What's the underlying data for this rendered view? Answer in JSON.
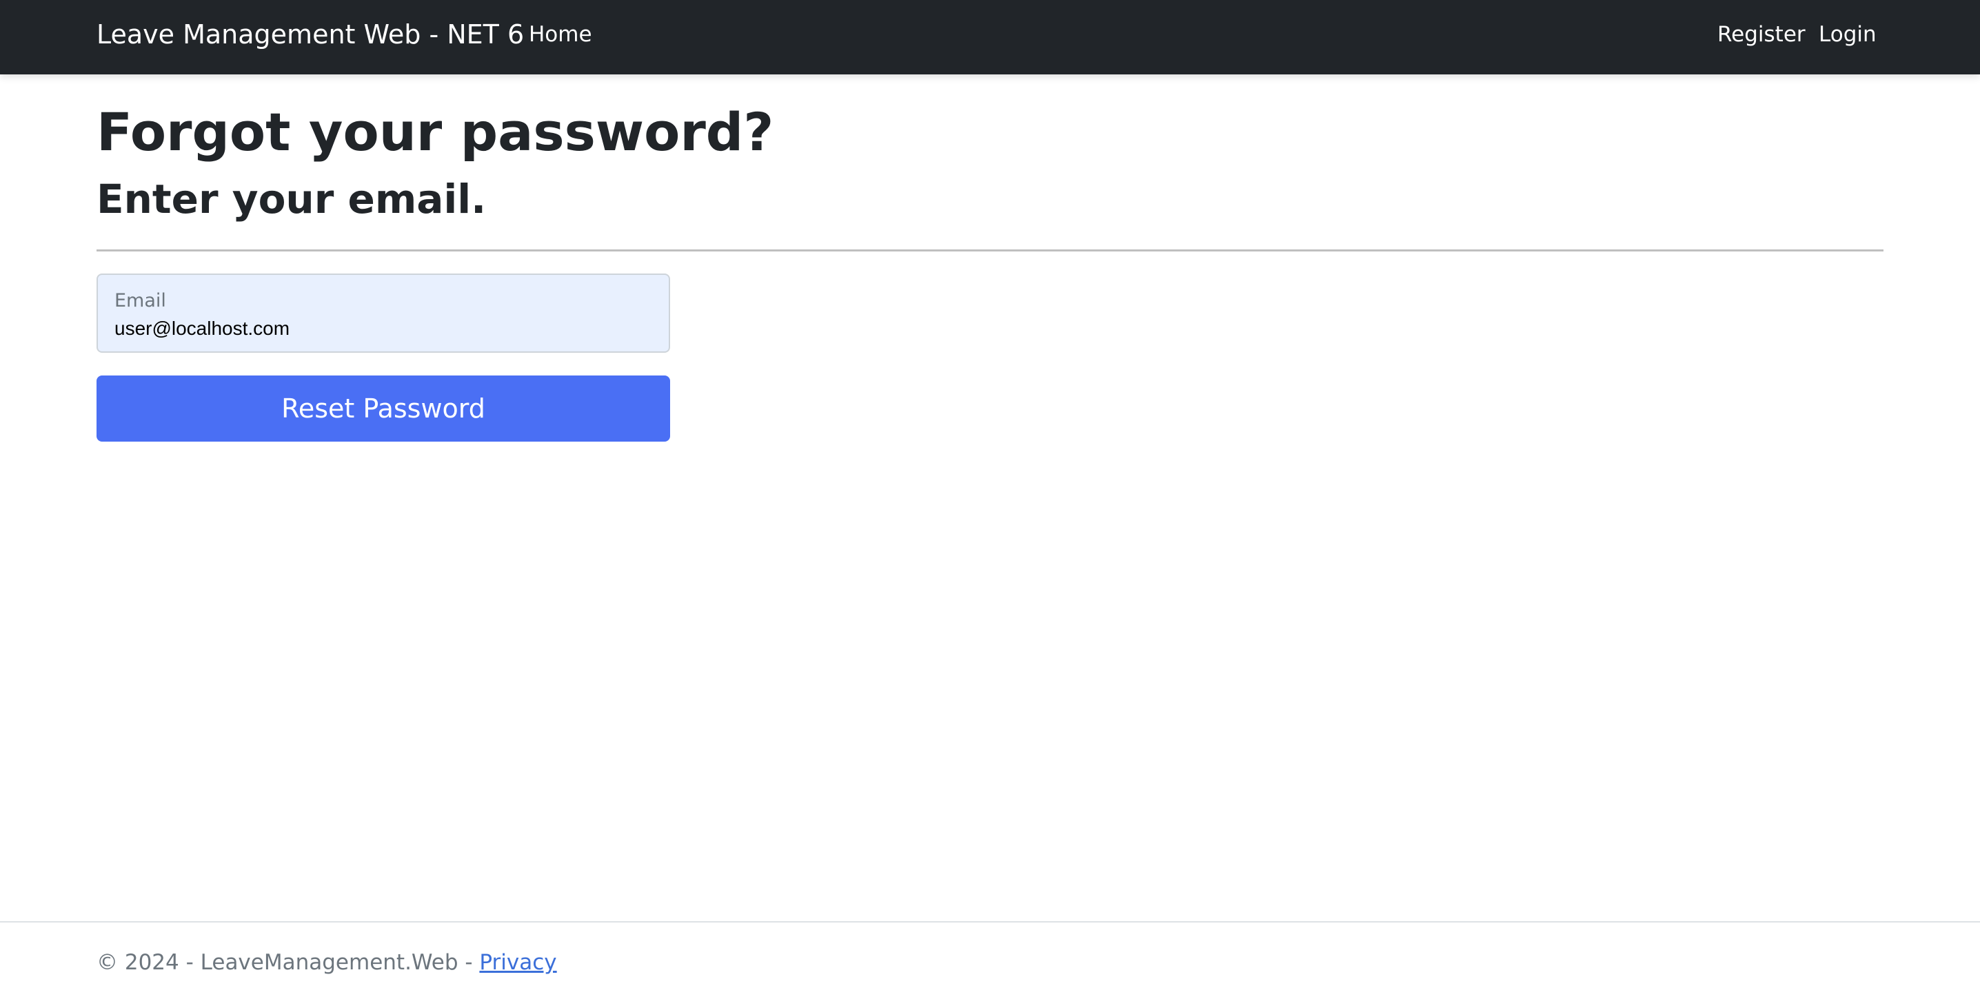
{
  "navbar": {
    "brand": "Leave Management Web - NET 6",
    "links": {
      "home": "Home",
      "register": "Register",
      "login": "Login"
    }
  },
  "main": {
    "title": "Forgot your password?",
    "subtitle": "Enter your email.",
    "email_field": {
      "label": "Email",
      "value": "user@localhost.com"
    },
    "reset_button": "Reset Password"
  },
  "footer": {
    "text": "© 2024 - LeaveManagement.Web - ",
    "privacy_link": "Privacy"
  },
  "colors": {
    "navbar_bg": "#212529",
    "primary_button": "#4a6ff4",
    "input_autofill_bg": "#e8f0fe",
    "link": "#3b6fd9"
  }
}
